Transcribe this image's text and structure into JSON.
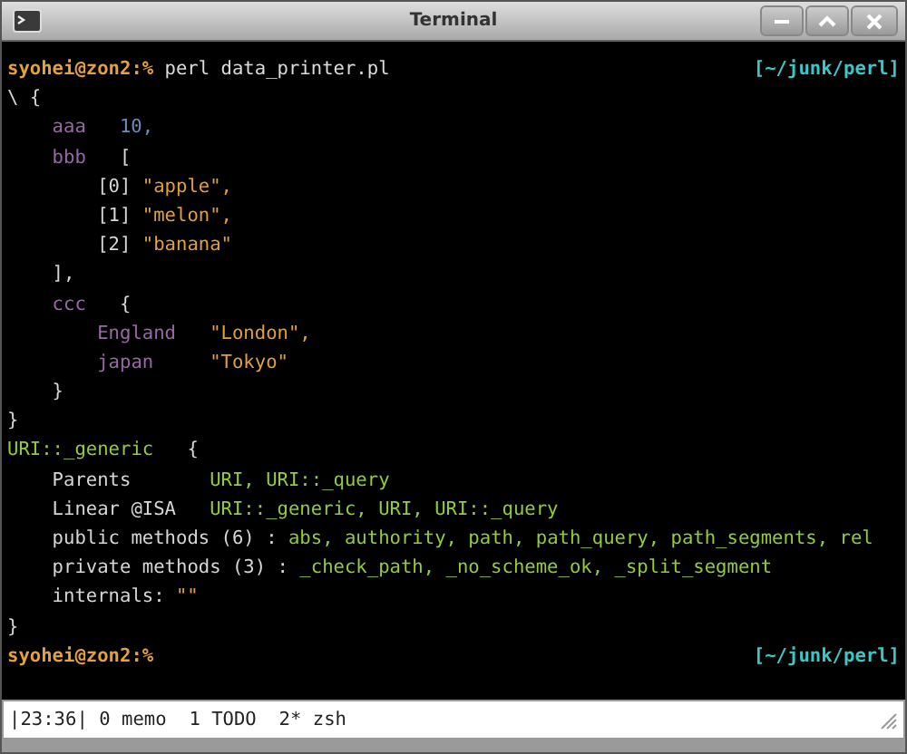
{
  "window": {
    "title": "Terminal"
  },
  "terminal": {
    "blocks": [
      {
        "kind": "prompt",
        "prompt": "syohei@zon2:%",
        "command": "perl data_printer.pl",
        "path": "[~/junk/perl]"
      },
      {
        "kind": "tree",
        "nodes": [
          {
            "segments": [
              {
                "text": "\\",
                "kind": "plain"
              },
              {
                "text": "{",
                "kind": "plain"
              }
            ],
            "children": [
              {
                "key": {
                  "text": "aaa",
                  "kind": "key"
                },
                "segments": [
                  {
                    "text": "10,",
                    "kind": "number"
                  }
                ]
              },
              {
                "key": {
                  "text": "bbb",
                  "kind": "key"
                },
                "segments": [
                  {
                    "text": "[",
                    "kind": "plain"
                  }
                ],
                "children": [
                  {
                    "segments": [
                      {
                        "text": "[0]",
                        "kind": "plain"
                      },
                      {
                        "text": "\"apple\",",
                        "kind": "string"
                      }
                    ]
                  },
                  {
                    "segments": [
                      {
                        "text": "[1]",
                        "kind": "plain"
                      },
                      {
                        "text": "\"melon\",",
                        "kind": "string"
                      }
                    ]
                  },
                  {
                    "segments": [
                      {
                        "text": "[2]",
                        "kind": "plain"
                      },
                      {
                        "text": "\"banana\"",
                        "kind": "string"
                      }
                    ]
                  }
                ]
              },
              {
                "segments": [
                  {
                    "text": "],",
                    "kind": "plain"
                  }
                ]
              },
              {
                "key": {
                  "text": "ccc",
                  "kind": "key"
                },
                "segments": [
                  {
                    "text": "{",
                    "kind": "plain"
                  }
                ],
                "children": [
                  {
                    "key": {
                      "text": "England",
                      "kind": "key"
                    },
                    "segments": [
                      {
                        "text": "\"London\",",
                        "kind": "string"
                      }
                    ]
                  },
                  {
                    "key": {
                      "text": "japan",
                      "kind": "key"
                    },
                    "segments": [
                      {
                        "text": "\"Tokyo\"",
                        "kind": "string"
                      }
                    ]
                  }
                ]
              },
              {
                "segments": [
                  {
                    "text": "}",
                    "kind": "plain"
                  }
                ]
              }
            ]
          },
          {
            "segments": [
              {
                "text": "}",
                "kind": "plain"
              }
            ]
          },
          {
            "key": {
              "text": "URI::_generic",
              "kind": "class"
            },
            "segments": [
              {
                "text": "{",
                "kind": "plain"
              }
            ],
            "children": [
              {
                "key": {
                  "text": "Parents",
                  "kind": "plain"
                },
                "segments": [
                  {
                    "text": "URI, URI::_query",
                    "kind": "class"
                  }
                ]
              },
              {
                "key": {
                  "text": "Linear @ISA",
                  "kind": "plain"
                },
                "segments": [
                  {
                    "text": "URI::_generic, URI, URI::_query",
                    "kind": "class"
                  }
                ]
              },
              {
                "segments": [
                  {
                    "text": "public methods (6) :",
                    "kind": "plain"
                  },
                  {
                    "text": "abs, authority, path, path_query, path_segments, rel",
                    "kind": "class"
                  }
                ]
              },
              {
                "segments": [
                  {
                    "text": "private methods (3) :",
                    "kind": "plain"
                  },
                  {
                    "text": "_check_path, _no_scheme_ok, _split_segment",
                    "kind": "class"
                  }
                ]
              },
              {
                "segments": [
                  {
                    "text": "internals:",
                    "kind": "plain"
                  },
                  {
                    "text": "\"\"",
                    "kind": "string"
                  }
                ]
              }
            ]
          },
          {
            "segments": [
              {
                "text": "}",
                "kind": "plain"
              }
            ]
          }
        ]
      },
      {
        "kind": "prompt",
        "prompt": "syohei@zon2:%",
        "path": "[~/junk/perl]"
      }
    ]
  },
  "status_bar": {
    "clock": "|23:36|",
    "windows": [
      "0 memo",
      "1 TODO",
      "2* zsh"
    ]
  }
}
